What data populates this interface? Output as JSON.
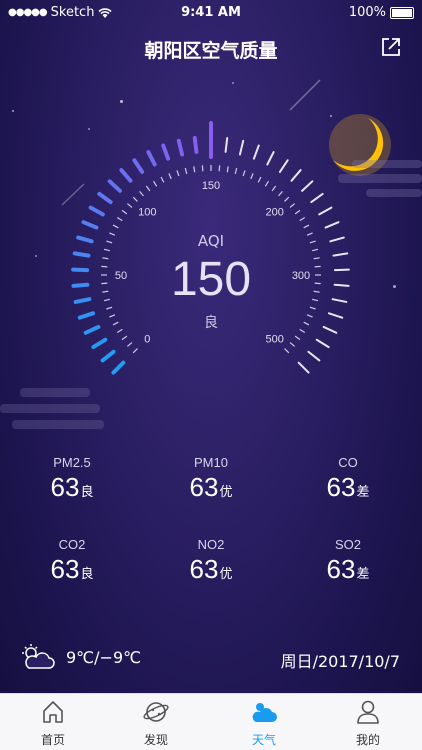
{
  "status_bar": {
    "carrier": "Sketch",
    "time": "9:41 AM",
    "battery": "100%"
  },
  "header": {
    "title": "朝阳区空气质量"
  },
  "gauge": {
    "label": "AQI",
    "value": "150",
    "level": "良",
    "ticks": [
      "0",
      "50",
      "100",
      "150",
      "200",
      "300",
      "500"
    ],
    "progress_fraction": 0.5
  },
  "metrics": [
    {
      "name": "PM2.5",
      "value": "63",
      "level": "良"
    },
    {
      "name": "PM10",
      "value": "63",
      "level": "优"
    },
    {
      "name": "CO",
      "value": "63",
      "level": "差"
    },
    {
      "name": "CO2",
      "value": "63",
      "level": "良"
    },
    {
      "name": "NO2",
      "value": "63",
      "level": "优"
    },
    {
      "name": "SO2",
      "value": "63",
      "level": "差"
    }
  ],
  "weather": {
    "temperature": "9℃/−9℃",
    "date": "周日/2017/10/7"
  },
  "tabs": [
    {
      "label": "首页",
      "icon": "home-icon"
    },
    {
      "label": "发现",
      "icon": "planet-icon"
    },
    {
      "label": "天气",
      "icon": "weather-icon"
    },
    {
      "label": "我的",
      "icon": "profile-icon"
    }
  ],
  "colors": {
    "accent": "#1a9bf0",
    "gauge_start": "#1e9ff2",
    "gauge_end": "#8a5cf0",
    "moon": "#ffc107"
  }
}
